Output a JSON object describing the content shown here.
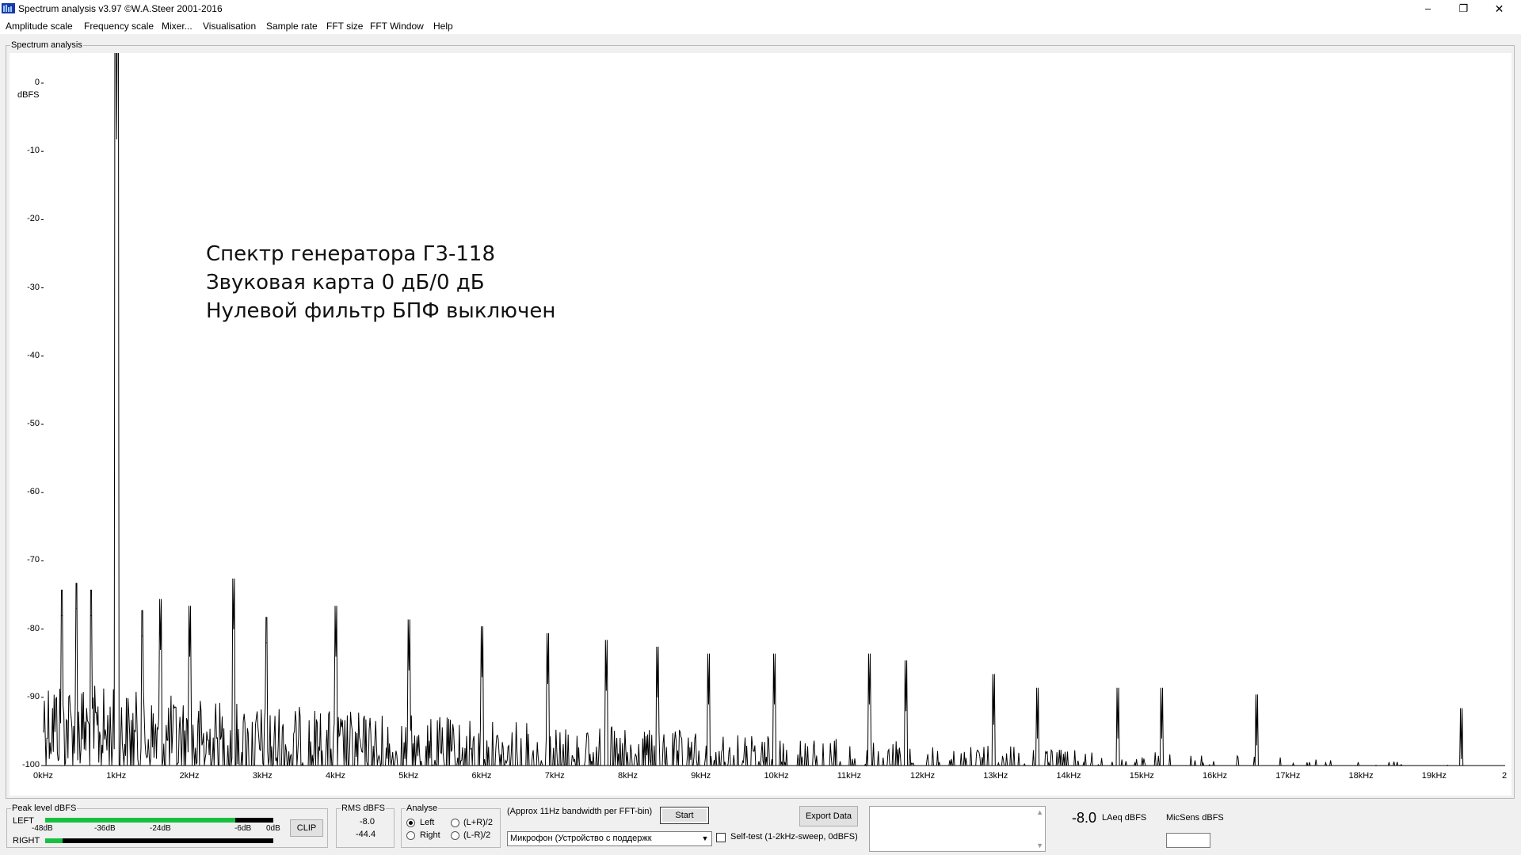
{
  "window": {
    "title": "Spectrum analysis v3.97  ©W.A.Steer 2001-2016",
    "minimize": "–",
    "maximize": "❐",
    "close": "✕"
  },
  "menu": [
    "Amplitude scale",
    "Frequency scale",
    "Mixer...",
    "Visualisation",
    "Sample rate",
    "FFT size",
    "FFT Window",
    "Help"
  ],
  "spectrum": {
    "group_label": "Spectrum analysis",
    "annotation": [
      "Спектр генератора Г3-118",
      "Звуковая карта 0 дБ/0 дБ",
      "Нулевой фильтр БПФ выключен"
    ]
  },
  "chart_data": {
    "type": "line",
    "ylabel": "dBFS",
    "ylim": [
      -100,
      0
    ],
    "xlim": [
      0,
      20
    ],
    "x_unit": "kHz",
    "y_ticks": [
      {
        "value": 0,
        "label": "0"
      },
      {
        "value": -10,
        "label": "-10"
      },
      {
        "value": -20,
        "label": "-20"
      },
      {
        "value": -30,
        "label": "-30"
      },
      {
        "value": -40,
        "label": "-40"
      },
      {
        "value": -50,
        "label": "-50"
      },
      {
        "value": -60,
        "label": "-60"
      },
      {
        "value": -70,
        "label": "-70"
      },
      {
        "value": -80,
        "label": "-80"
      },
      {
        "value": -90,
        "label": "-90"
      },
      {
        "value": -100,
        "label": "-100"
      }
    ],
    "x_ticks": [
      {
        "value": 0,
        "label": "0kHz"
      },
      {
        "value": 1,
        "label": "1kHz"
      },
      {
        "value": 2,
        "label": "2kHz"
      },
      {
        "value": 3,
        "label": "3kHz"
      },
      {
        "value": 4,
        "label": "4kHz"
      },
      {
        "value": 5,
        "label": "5kHz"
      },
      {
        "value": 6,
        "label": "6kHz"
      },
      {
        "value": 7,
        "label": "7kHz"
      },
      {
        "value": 8,
        "label": "8kHz"
      },
      {
        "value": 9,
        "label": "9kHz"
      },
      {
        "value": 10,
        "label": "10kHz"
      },
      {
        "value": 11,
        "label": "11kHz"
      },
      {
        "value": 12,
        "label": "12kHz"
      },
      {
        "value": 13,
        "label": "13kHz"
      },
      {
        "value": 14,
        "label": "14kHz"
      },
      {
        "value": 15,
        "label": "15kHz"
      },
      {
        "value": 16,
        "label": "16kHz"
      },
      {
        "value": 17,
        "label": "17kHz"
      },
      {
        "value": 18,
        "label": "18kHz"
      },
      {
        "value": 19,
        "label": "19kHz"
      },
      {
        "value": 20,
        "label": "2"
      }
    ],
    "peaks": [
      {
        "x": 1.0,
        "y": -8.2
      },
      {
        "x": 0.25,
        "y": -78
      },
      {
        "x": 0.45,
        "y": -77
      },
      {
        "x": 0.65,
        "y": -78
      },
      {
        "x": 1.35,
        "y": -81
      },
      {
        "x": 1.6,
        "y": -83
      },
      {
        "x": 2.0,
        "y": -84
      },
      {
        "x": 2.6,
        "y": -80
      },
      {
        "x": 3.05,
        "y": -82
      },
      {
        "x": 4.0,
        "y": -84
      },
      {
        "x": 5.0,
        "y": -86
      },
      {
        "x": 6.0,
        "y": -87
      },
      {
        "x": 6.9,
        "y": -88
      },
      {
        "x": 7.7,
        "y": -89
      },
      {
        "x": 8.4,
        "y": -90
      },
      {
        "x": 9.1,
        "y": -91
      },
      {
        "x": 10.0,
        "y": -91
      },
      {
        "x": 11.3,
        "y": -91
      },
      {
        "x": 11.8,
        "y": -92
      },
      {
        "x": 13.0,
        "y": -94
      },
      {
        "x": 13.6,
        "y": -96
      },
      {
        "x": 14.7,
        "y": -96
      },
      {
        "x": 15.3,
        "y": -96
      },
      {
        "x": 16.6,
        "y": -97
      },
      {
        "x": 19.4,
        "y": -99
      }
    ],
    "noise_floor": {
      "start_level": -86,
      "end_level": -100,
      "variation": 14
    }
  },
  "bottom": {
    "peak_label": "Peak level dBFS",
    "left": "LEFT",
    "right": "RIGHT",
    "meter_scale": [
      "-48dB",
      "-36dB",
      "-24dB",
      "-6dB",
      "0dB"
    ],
    "left_level_db": -8.0,
    "right_level_db": -44.4,
    "clip": "CLIP",
    "rms_label": "RMS dBFS",
    "rms_left": "-8.0",
    "rms_right": "-44.4",
    "analyse_label": "Analyse",
    "radio_left": "Left",
    "radio_right": "Right",
    "radio_sum": "(L+R)/2",
    "radio_diff": "(L-R)/2",
    "bandwidth": "(Approx 11Hz bandwidth per FFT-bin)",
    "start": "Start",
    "device": "Микрофон (Устройство с поддержк",
    "selftest": "Self-test  (1-2kHz-sweep, 0dBFS)",
    "export": "Export Data",
    "laeq_value": "-8.0",
    "laeq_label": "LAeq dBFS",
    "micsens_label": "MicSens dBFS"
  }
}
